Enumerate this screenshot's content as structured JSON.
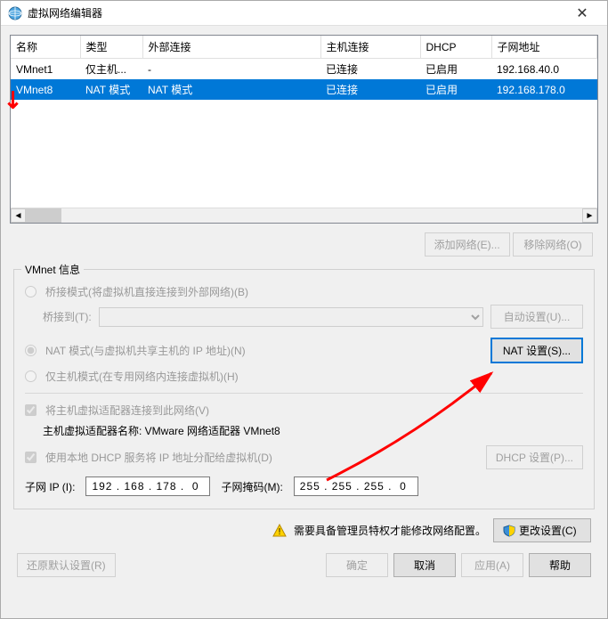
{
  "title": "虚拟网络编辑器",
  "table": {
    "headers": [
      "名称",
      "类型",
      "外部连接",
      "主机连接",
      "DHCP",
      "子网地址"
    ],
    "rows": [
      {
        "name": "VMnet1",
        "type": "仅主机...",
        "ext": "-",
        "host": "已连接",
        "dhcp": "已启用",
        "subnet": "192.168.40.0"
      },
      {
        "name": "VMnet8",
        "type": "NAT 模式",
        "ext": "NAT 模式",
        "host": "已连接",
        "dhcp": "已启用",
        "subnet": "192.168.178.0"
      }
    ]
  },
  "buttons": {
    "add_network": "添加网络(E)...",
    "remove_network": "移除网络(O)",
    "auto_settings": "自动设置(U)...",
    "nat_settings": "NAT 设置(S)...",
    "dhcp_settings": "DHCP 设置(P)...",
    "change_settings": "更改设置(C)",
    "restore_default": "还原默认设置(R)",
    "ok": "确定",
    "cancel": "取消",
    "apply": "应用(A)",
    "help": "帮助"
  },
  "fieldset": {
    "legend": "VMnet 信息",
    "bridge_label": "桥接模式(将虚拟机直接连接到外部网络)(B)",
    "bridge_to": "桥接到(T):",
    "nat_label": "NAT 模式(与虚拟机共享主机的 IP 地址)(N)",
    "hostonly_label": "仅主机模式(在专用网络内连接虚拟机)(H)",
    "connect_adapter_label": "将主机虚拟适配器连接到此网络(V)",
    "adapter_name_label": "主机虚拟适配器名称: VMware 网络适配器 VMnet8",
    "dhcp_label": "使用本地 DHCP 服务将 IP 地址分配给虚拟机(D)",
    "subnet_ip_label": "子网 IP (I):",
    "subnet_ip_value": "192 . 168 . 178 .  0",
    "subnet_mask_label": "子网掩码(M):",
    "subnet_mask_value": "255 . 255 . 255 .  0"
  },
  "admin_warning": "需要具备管理员特权才能修改网络配置。"
}
